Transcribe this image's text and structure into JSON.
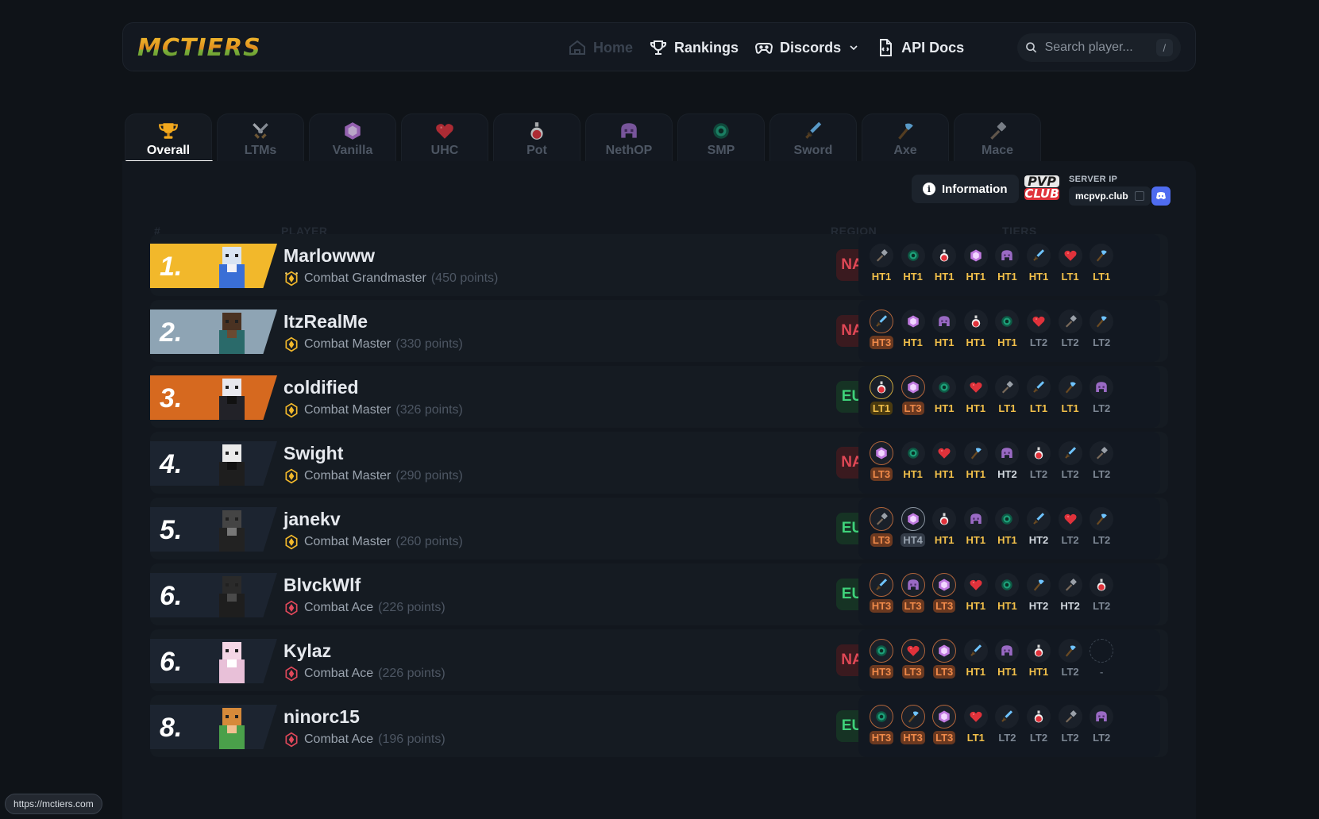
{
  "brand": {
    "logo": "MCTIERS"
  },
  "nav": {
    "home": "Home",
    "rankings": "Rankings",
    "discords": "Discords",
    "api_docs": "API Docs"
  },
  "search": {
    "placeholder": "Search player...",
    "shortcut": "/"
  },
  "tabs": [
    {
      "label": "Overall",
      "icon": "trophy-icon",
      "active": true
    },
    {
      "label": "LTMs",
      "icon": "crossed-swords-icon"
    },
    {
      "label": "Vanilla",
      "icon": "crystal-icon"
    },
    {
      "label": "UHC",
      "icon": "heart-icon"
    },
    {
      "label": "Pot",
      "icon": "potion-icon"
    },
    {
      "label": "NethOP",
      "icon": "netherite-helmet-icon"
    },
    {
      "label": "SMP",
      "icon": "ender-pearl-icon"
    },
    {
      "label": "Sword",
      "icon": "sword-icon"
    },
    {
      "label": "Axe",
      "icon": "axe-icon"
    },
    {
      "label": "Mace",
      "icon": "mace-icon"
    }
  ],
  "panel": {
    "information_label": "Information",
    "server_ip_label": "SERVER IP",
    "server_ip": "mcpvp.club",
    "pvp_logo_top": "PVP",
    "pvp_logo_bottom": "CLUB"
  },
  "columns": {
    "rank": "#",
    "player": "PLAYER",
    "region": "REGION",
    "tiers": "TIERS"
  },
  "colors": {
    "gold_rank": "#f2b82b",
    "silver_rank": "#8ea4b4",
    "bronze_rank": "#d6691f",
    "dark_rank": "#1c2430",
    "region_na": "#e04856",
    "region_eu": "#3fd27a"
  },
  "players": [
    {
      "rank": "1.",
      "name": "Marlowww",
      "title": "Combat Grandmaster",
      "points": "(450 points)",
      "region": "NA",
      "badge": "grandmaster",
      "tiers": [
        [
          "mace",
          "HT1",
          "gold"
        ],
        [
          "smp",
          "HT1",
          "gold"
        ],
        [
          "pot",
          "HT1",
          "gold"
        ],
        [
          "vanilla",
          "HT1",
          "gold"
        ],
        [
          "nethop",
          "HT1",
          "gold"
        ],
        [
          "sword",
          "HT1",
          "gold"
        ],
        [
          "uhc",
          "LT1",
          "gold"
        ],
        [
          "axe",
          "LT1",
          "gold"
        ]
      ]
    },
    {
      "rank": "2.",
      "name": "ItzRealMe",
      "title": "Combat Master",
      "points": "(330 points)",
      "region": "NA",
      "badge": "master",
      "tiers": [
        [
          "sword",
          "HT3",
          "bronze"
        ],
        [
          "vanilla",
          "HT1",
          "gold"
        ],
        [
          "nethop",
          "HT1",
          "gold"
        ],
        [
          "pot",
          "HT1",
          "gold"
        ],
        [
          "smp",
          "HT1",
          "gold"
        ],
        [
          "uhc",
          "LT2",
          "lt2"
        ],
        [
          "mace",
          "LT2",
          "lt2"
        ],
        [
          "axe",
          "LT2",
          "lt2"
        ]
      ]
    },
    {
      "rank": "3.",
      "name": "coldified",
      "title": "Combat Master",
      "points": "(326 points)",
      "region": "EU",
      "badge": "master",
      "tiers": [
        [
          "pot",
          "LT1",
          "goldbg"
        ],
        [
          "vanilla",
          "LT3",
          "bronze"
        ],
        [
          "smp",
          "HT1",
          "gold"
        ],
        [
          "uhc",
          "HT1",
          "gold"
        ],
        [
          "mace",
          "LT1",
          "gold"
        ],
        [
          "sword",
          "LT1",
          "gold"
        ],
        [
          "axe",
          "LT1",
          "gold"
        ],
        [
          "nethop",
          "LT2",
          "lt2"
        ]
      ]
    },
    {
      "rank": "4.",
      "name": "Swight",
      "title": "Combat Master",
      "points": "(290 points)",
      "region": "NA",
      "badge": "master",
      "tiers": [
        [
          "vanilla",
          "LT3",
          "bronze"
        ],
        [
          "smp",
          "HT1",
          "gold"
        ],
        [
          "uhc",
          "HT1",
          "gold"
        ],
        [
          "axe",
          "HT1",
          "gold"
        ],
        [
          "nethop",
          "HT2",
          "ht2"
        ],
        [
          "pot",
          "LT2",
          "lt2"
        ],
        [
          "sword",
          "LT2",
          "lt2"
        ],
        [
          "mace",
          "LT2",
          "lt2"
        ]
      ]
    },
    {
      "rank": "5.",
      "name": "janekv",
      "title": "Combat Master",
      "points": "(260 points)",
      "region": "EU",
      "badge": "master",
      "tiers": [
        [
          "mace",
          "LT3",
          "bronze"
        ],
        [
          "vanilla",
          "HT4",
          "silver"
        ],
        [
          "pot",
          "HT1",
          "gold"
        ],
        [
          "nethop",
          "HT1",
          "gold"
        ],
        [
          "smp",
          "HT1",
          "gold"
        ],
        [
          "sword",
          "HT2",
          "ht2"
        ],
        [
          "uhc",
          "LT2",
          "lt2"
        ],
        [
          "axe",
          "LT2",
          "lt2"
        ]
      ]
    },
    {
      "rank": "6.",
      "name": "BlvckWlf",
      "title": "Combat Ace",
      "points": "(226 points)",
      "region": "EU",
      "badge": "ace",
      "tiers": [
        [
          "sword",
          "HT3",
          "bronze"
        ],
        [
          "nethop",
          "LT3",
          "bronze"
        ],
        [
          "vanilla",
          "LT3",
          "bronze"
        ],
        [
          "uhc",
          "HT1",
          "gold"
        ],
        [
          "smp",
          "HT1",
          "gold"
        ],
        [
          "axe",
          "HT2",
          "ht2"
        ],
        [
          "mace",
          "HT2",
          "ht2"
        ],
        [
          "pot",
          "LT2",
          "lt2"
        ]
      ]
    },
    {
      "rank": "6.",
      "name": "Kylaz",
      "title": "Combat Ace",
      "points": "(226 points)",
      "region": "NA",
      "badge": "ace",
      "tiers": [
        [
          "smp",
          "HT3",
          "bronze"
        ],
        [
          "uhc",
          "LT3",
          "bronze"
        ],
        [
          "vanilla",
          "LT3",
          "bronze"
        ],
        [
          "sword",
          "HT1",
          "gold"
        ],
        [
          "nethop",
          "HT1",
          "gold"
        ],
        [
          "pot",
          "HT1",
          "gold"
        ],
        [
          "axe",
          "LT2",
          "lt2"
        ],
        [
          "empty",
          "-",
          "dash"
        ]
      ]
    },
    {
      "rank": "8.",
      "name": "ninorc15",
      "title": "Combat Ace",
      "points": "(196 points)",
      "region": "EU",
      "badge": "ace",
      "tiers": [
        [
          "smp",
          "HT3",
          "bronze"
        ],
        [
          "axe",
          "HT3",
          "bronze"
        ],
        [
          "vanilla",
          "LT3",
          "bronze"
        ],
        [
          "uhc",
          "LT1",
          "gold"
        ],
        [
          "sword",
          "LT2",
          "lt2"
        ],
        [
          "pot",
          "LT2",
          "lt2"
        ],
        [
          "mace",
          "LT2",
          "lt2"
        ],
        [
          "nethop",
          "LT2",
          "lt2"
        ]
      ]
    }
  ],
  "status_url": "https://mctiers.com"
}
